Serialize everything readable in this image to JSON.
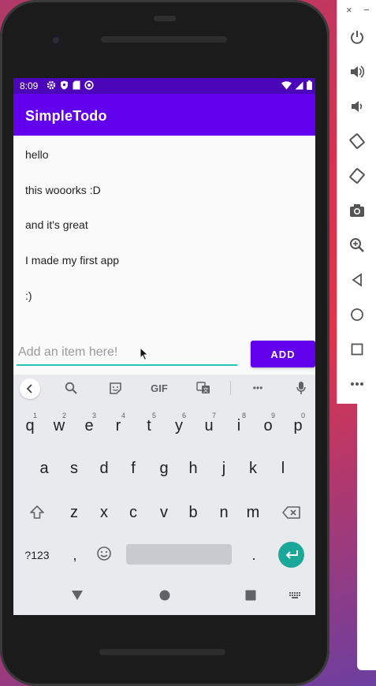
{
  "emulator": {
    "close_label": "×",
    "minimize_label": "−",
    "tools": [
      "power-icon",
      "volume-up-icon",
      "volume-down-icon",
      "rotate-left-icon",
      "rotate-right-icon",
      "camera-icon",
      "zoom-icon",
      "back-icon",
      "home-icon",
      "overview-icon",
      "more-icon"
    ]
  },
  "status_bar": {
    "time": "8:09"
  },
  "app": {
    "title": "SimpleTodo",
    "items": [
      "hello",
      "this wooorks :D",
      "and it's great",
      "I made my first app",
      ":)"
    ],
    "input_placeholder": "Add an item here!",
    "input_value": "",
    "add_label": "ADD",
    "accent_color": "#6200ee",
    "status_color": "#4a06b8"
  },
  "keyboard": {
    "toolbar": [
      "back-icon",
      "search-icon",
      "sticker-icon",
      "gif-label",
      "translate-icon",
      "more-icon",
      "mic-icon"
    ],
    "gif_label": "GIF",
    "more_label": "•••",
    "row1": [
      "q",
      "w",
      "e",
      "r",
      "t",
      "y",
      "u",
      "i",
      "o",
      "p"
    ],
    "row1_hints": [
      "1",
      "2",
      "3",
      "4",
      "5",
      "6",
      "7",
      "8",
      "9",
      "0"
    ],
    "row2": [
      "a",
      "s",
      "d",
      "f",
      "g",
      "h",
      "j",
      "k",
      "l"
    ],
    "row3": [
      "z",
      "x",
      "c",
      "v",
      "b",
      "n",
      "m"
    ],
    "symbols_label": "?123",
    "comma_label": ",",
    "period_label": "."
  }
}
